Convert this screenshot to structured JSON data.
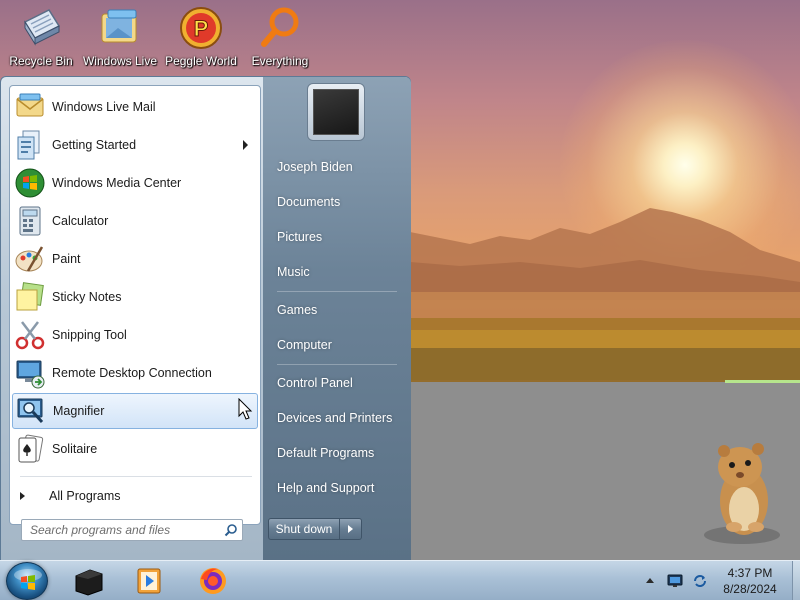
{
  "desktop": {
    "icons": [
      {
        "label": "Recycle Bin",
        "icon": "recycle-bin-icon"
      },
      {
        "label": "Windows Live",
        "icon": "windows-live-icon"
      },
      {
        "label": "Peggle World",
        "icon": "peggle-world-icon"
      },
      {
        "label": "Everything",
        "icon": "everything-search-icon"
      }
    ]
  },
  "start_menu": {
    "programs": [
      {
        "label": "Windows Live Mail",
        "icon": "windows-live-mail-icon"
      },
      {
        "label": "Getting Started",
        "icon": "getting-started-icon",
        "has_submenu": true
      },
      {
        "label": "Windows Media Center",
        "icon": "windows-media-center-icon"
      },
      {
        "label": "Calculator",
        "icon": "calculator-icon"
      },
      {
        "label": "Paint",
        "icon": "paint-icon"
      },
      {
        "label": "Sticky Notes",
        "icon": "sticky-notes-icon"
      },
      {
        "label": "Snipping Tool",
        "icon": "snipping-tool-icon"
      },
      {
        "label": "Remote Desktop Connection",
        "icon": "remote-desktop-icon"
      },
      {
        "label": "Magnifier",
        "icon": "magnifier-icon",
        "highlighted": true
      },
      {
        "label": "Solitaire",
        "icon": "solitaire-icon"
      }
    ],
    "all_programs_label": "All Programs",
    "search": {
      "placeholder": "Search programs and files"
    },
    "places": [
      {
        "label": "Joseph Biden"
      },
      {
        "label": "Documents"
      },
      {
        "label": "Pictures"
      },
      {
        "label": "Music"
      },
      {
        "label": "Games"
      },
      {
        "label": "Computer"
      },
      {
        "label": "Control Panel"
      },
      {
        "label": "Devices and Printers"
      },
      {
        "label": "Default Programs"
      },
      {
        "label": "Help and Support"
      }
    ],
    "shutdown_label": "Shut down"
  },
  "taskbar": {
    "pinned": [
      {
        "icon": "terminal-app-icon"
      },
      {
        "icon": "media-player-icon"
      },
      {
        "icon": "firefox-icon"
      }
    ],
    "tray_icons": [
      "show-hidden-icons-arrow",
      "network-icon",
      "sync-icon"
    ],
    "clock": {
      "time": "4:37 PM",
      "date": "8/28/2024"
    }
  },
  "colors": {
    "taskbar": "#a9c0d6",
    "start_menu_right_pane": "#6c8398",
    "highlight": "#d2e4f8"
  }
}
